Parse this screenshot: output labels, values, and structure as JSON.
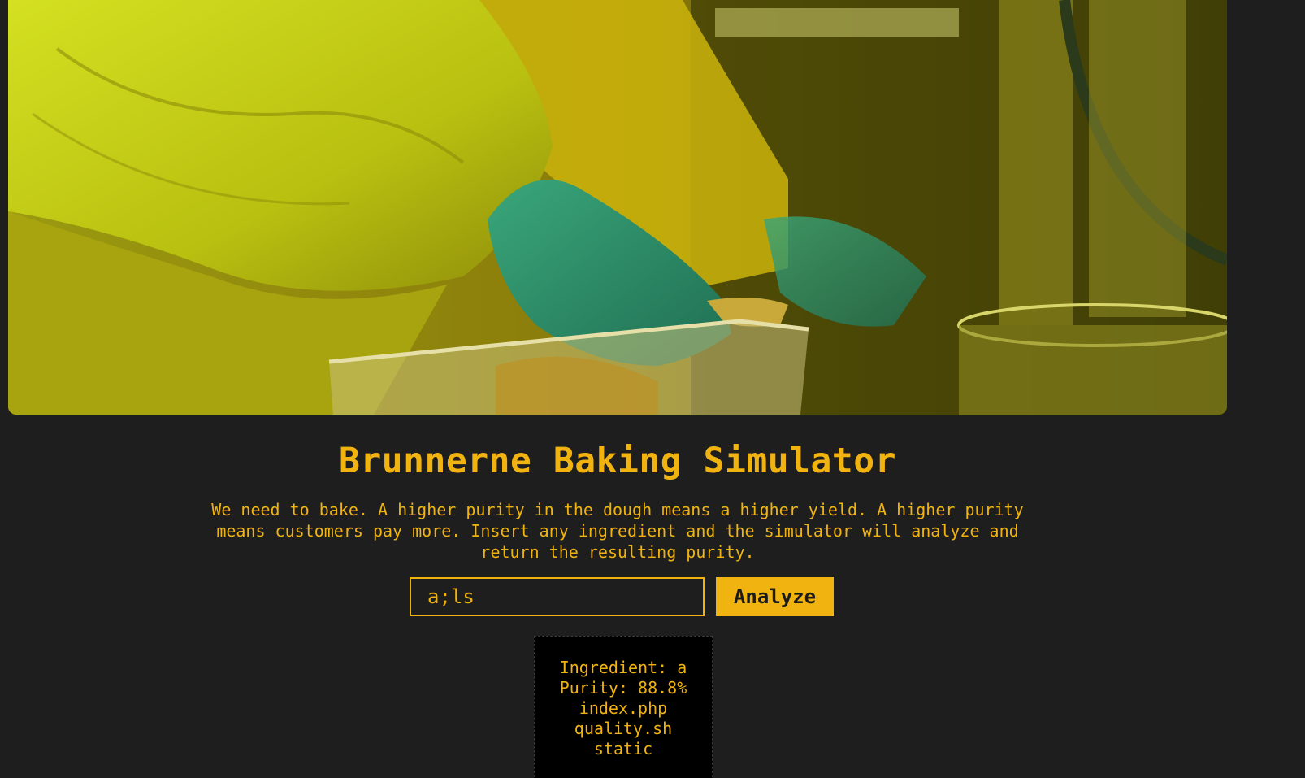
{
  "hero": {
    "alt": "Gloved hand in yellow hazmat suit picking from a plastic container in a lab"
  },
  "page": {
    "title": "Brunnerne Baking Simulator",
    "description": "We need to bake. A higher purity in the dough means a higher yield. A higher purity means customers pay more. Insert any ingredient and the simulator will analyze and return the resulting purity."
  },
  "form": {
    "input_value": "a;ls",
    "button_label": "Analyze"
  },
  "result": {
    "lines": [
      "Ingredient: a",
      "Purity: 88.8%",
      "index.php",
      "quality.sh",
      "static"
    ]
  },
  "colors": {
    "accent": "#f0b30f",
    "background": "#1e1e1e",
    "output_bg": "#000000"
  }
}
